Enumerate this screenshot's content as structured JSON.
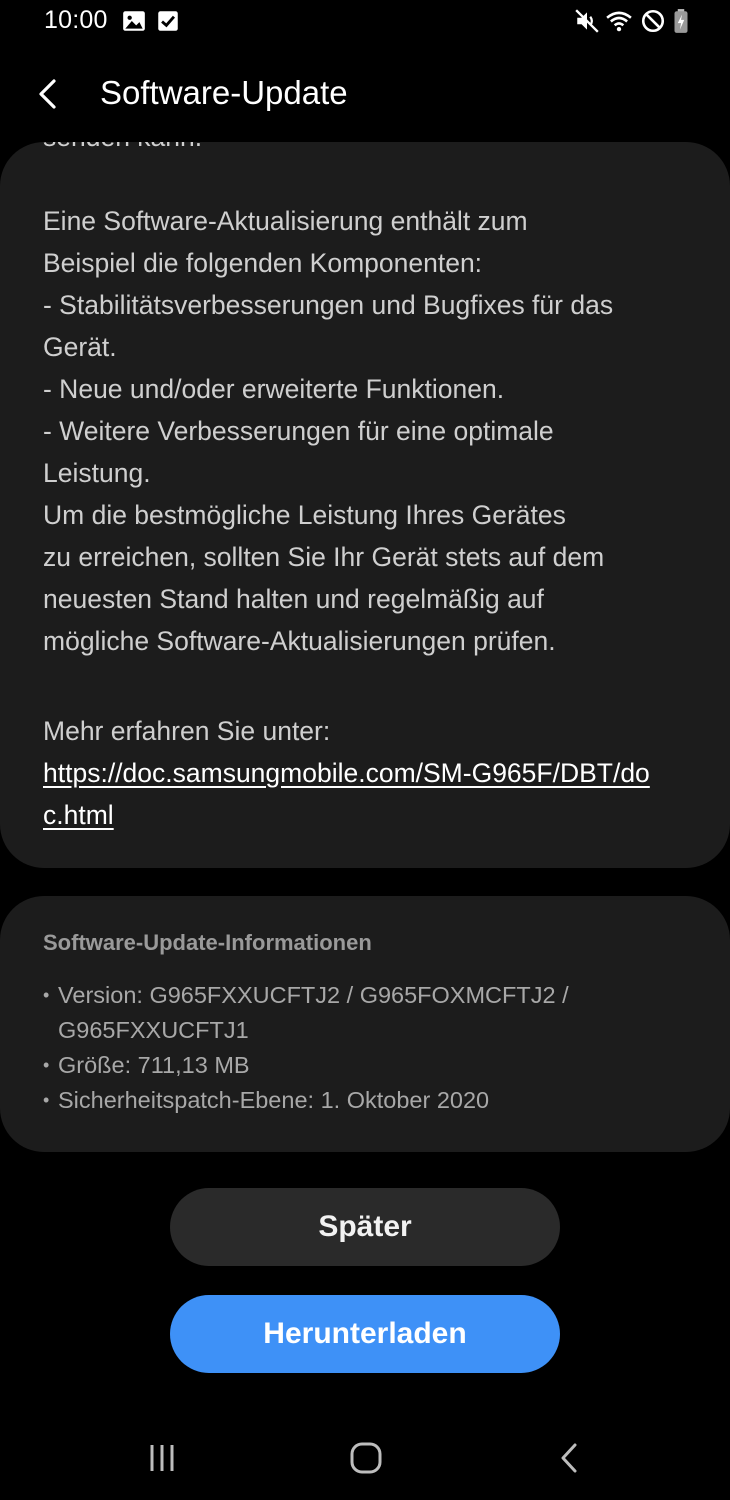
{
  "status_bar": {
    "time": "10:00",
    "left_icons": [
      "image-icon",
      "checkbox-icon"
    ],
    "right_icons": [
      "mute-icon",
      "wifi-icon",
      "do-not-disturb-icon",
      "battery-charging-icon"
    ]
  },
  "app_bar": {
    "back_icon": "back-arrow-icon",
    "title": "Software-Update"
  },
  "description": {
    "clipped_line": "senden kann.",
    "body": "Eine Software-Aktualisierung enthält zum\nBeispiel die folgenden Komponenten:\n - Stabilitätsverbesserungen und Bugfixes für das\nGerät.\n - Neue und/oder erweiterte Funktionen.\n - Weitere Verbesserungen für eine optimale\nLeistung.\nUm die bestmögliche Leistung Ihres Gerätes\nzu erreichen, sollten Sie Ihr Gerät stets auf dem\nneuesten Stand halten und regelmäßig auf\nmögliche Software-Aktualisierungen prüfen.",
    "more_label": "Mehr erfahren Sie unter:",
    "link": "https://doc.samsungmobile.com/SM-G965F/DBT/doc.html"
  },
  "info": {
    "heading": "Software-Update-Informationen",
    "items": [
      "Version: G965FXXUCFTJ2 / G965FOXMCFTJ2 / G965FXXUCFTJ1",
      "Größe: 711,13 MB",
      "Sicherheitspatch-Ebene: 1. Oktober 2020"
    ]
  },
  "buttons": {
    "later": "Später",
    "download": "Herunterladen"
  },
  "colors": {
    "background": "#000000",
    "card": "#1c1c1c",
    "primary_button": "#3e91f7",
    "secondary_button": "#2a2a2a"
  },
  "nav_bar": {
    "icons": [
      "recent-apps-icon",
      "home-icon",
      "back-icon"
    ]
  }
}
